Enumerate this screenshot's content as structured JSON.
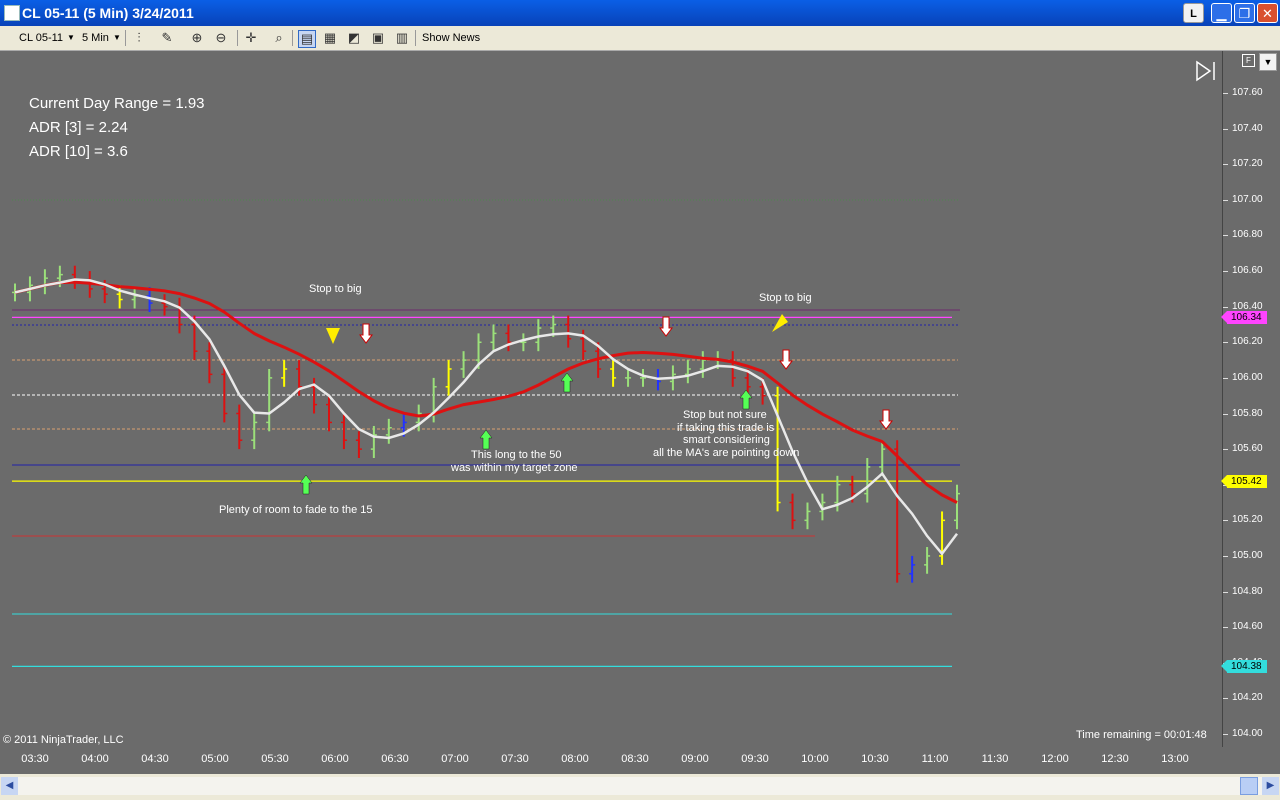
{
  "window": {
    "title": "CL 05-11 (5 Min)  3/24/2011",
    "buttons": {
      "link": "L",
      "minimize": "▁",
      "maximize": "❐",
      "close": "✕"
    }
  },
  "toolbar": {
    "instrument": "CL 05-11",
    "interval": "5 Min",
    "show_news": "Show News"
  },
  "overlay": {
    "current_day_range": "Current Day Range = 1.93",
    "adr3": "ADR [3] = 2.24",
    "adr10": "ADR [10] = 3.6",
    "copyright": "© 2011 NinjaTrader, LLC",
    "time_remaining": "Time remaining = 00:01:48"
  },
  "annotations": {
    "stop1": "Stop to big",
    "stop2": "Stop to big",
    "fade": "Plenty of room to fade to the 15",
    "long50_l1": "This long to the 50",
    "long50_l2": "was within my target zone",
    "notsure_l1": "Stop but not sure",
    "notsure_l2": "if taking this trade is",
    "notsure_l3": "smart considering",
    "notsure_l4": "all the MA's are pointing down"
  },
  "price_axis": {
    "labels": [
      "107.60",
      "107.40",
      "107.20",
      "107.00",
      "106.80",
      "106.60",
      "106.40",
      "106.20",
      "106.00",
      "105.80",
      "105.60",
      "105.40",
      "105.20",
      "105.00",
      "104.80",
      "104.60",
      "104.40",
      "104.20",
      "104.00"
    ],
    "badges": [
      {
        "value": "106.34",
        "color": "#ff44ff"
      },
      {
        "value": "105.42",
        "color": "#ffff00"
      },
      {
        "value": "104.38",
        "color": "#33dddd"
      }
    ]
  },
  "time_axis": {
    "labels": [
      "03:30",
      "04:00",
      "04:30",
      "05:00",
      "05:30",
      "06:00",
      "06:30",
      "07:00",
      "07:30",
      "08:00",
      "08:30",
      "09:00",
      "09:30",
      "10:00",
      "10:30",
      "11:00",
      "11:30",
      "12:00",
      "12:30",
      "13:00"
    ]
  },
  "chart_data": {
    "type": "line",
    "instrument": "CL 05-11",
    "ylim": [
      104.0,
      107.7
    ],
    "levels": [
      {
        "value": 106.34,
        "color": "#ff44ff"
      },
      {
        "value": 105.42,
        "color": "#ffff00"
      },
      {
        "value": 104.38,
        "color": "#33dddd"
      }
    ],
    "series": [
      {
        "values": [
          106.48,
          106.52,
          106.56,
          106.58,
          106.55,
          106.5,
          106.47,
          106.44,
          106.46,
          106.42,
          106.4,
          106.3,
          106.15,
          106.02,
          105.8,
          105.65,
          105.75,
          106.0,
          106.05,
          105.95,
          105.85,
          105.75,
          105.65,
          105.6,
          105.68,
          105.72,
          105.75,
          105.8,
          105.95,
          106.05,
          106.1,
          106.2,
          106.25,
          106.2,
          106.2,
          106.28,
          106.3,
          106.22,
          106.15,
          106.05,
          106.0,
          106.0,
          106.0,
          105.98,
          106.02,
          106.05,
          106.1,
          106.1,
          106.0,
          105.95,
          105.9,
          105.3,
          105.2,
          105.25,
          105.3,
          105.4,
          105.35,
          105.5,
          105.6,
          104.9,
          104.95,
          105.0,
          105.2,
          105.35
        ]
      }
    ]
  },
  "colors": {
    "ma_red": "#dd1111",
    "ma_white": "#e8e8e8",
    "bg": "#6b6b6b"
  }
}
